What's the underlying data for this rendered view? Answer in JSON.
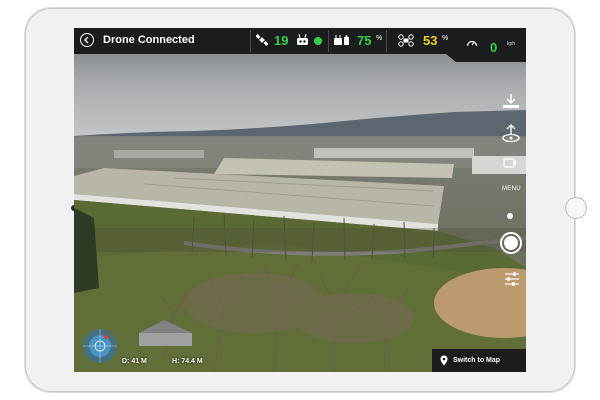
{
  "status_bar": {
    "title": "Drone Connected",
    "satellites": "19",
    "battery_drone_pct": "75",
    "battery_controller_pct": "53",
    "speed": "0",
    "percent_symbol": "%",
    "speed_unit": "kph"
  },
  "side_controls": {
    "menu_label": "MENU"
  },
  "telemetry": {
    "distance": "D: 41 M",
    "height": "H: 74.4 M"
  },
  "map_button": {
    "label": "Switch to Map"
  },
  "colors": {
    "bar_bg": "#1b1c1e",
    "green": "#35d04a",
    "yellow": "#f2d21b"
  },
  "icons": [
    "back-icon",
    "satellite-icon",
    "controller-icon",
    "drone-battery-icon",
    "drone-icon",
    "speedometer-icon",
    "download-icon",
    "takeoff-icon",
    "shutter-icon",
    "settings-sliders-icon",
    "location-pin-icon",
    "radar-icon"
  ]
}
